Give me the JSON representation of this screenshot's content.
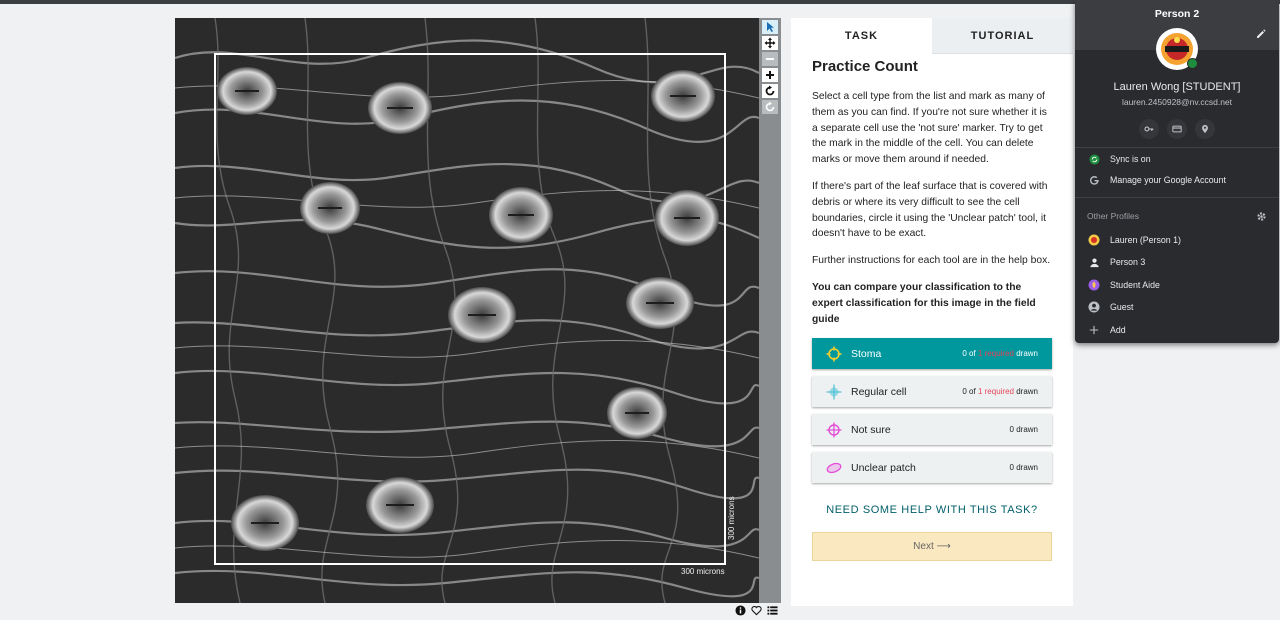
{
  "viewer": {
    "scale_h": "300 microns",
    "scale_v": "300 microns",
    "tools": [
      "pointer-icon",
      "move-icon",
      "zoom-out-icon",
      "zoom-in-icon",
      "rotate-icon",
      "reset-icon"
    ]
  },
  "tabs": {
    "task": "TASK",
    "tutorial": "TUTORIAL"
  },
  "task": {
    "title": "Practice Count",
    "para1": "Select a cell type from the list and mark as many of them as you can find. If you're not sure whether it is a separate cell use the 'not sure' marker. Try to get the mark in the middle of the cell. You can delete marks or move them around if needed.",
    "para2": "If there's part of the leaf surface that is covered with debris or where its very difficult to see the cell boundaries, circle it using the 'Unclear patch' tool, it doesn't have to be exact.",
    "para3": "Further instructions for each tool are in the help box.",
    "para4": "You can compare your classification to the expert classification for this image in the field guide",
    "tools": [
      {
        "label": "Stoma",
        "count_pre": "0 of ",
        "count_req": "1 required",
        "count_post": " drawn",
        "icon": "crosshair-icon",
        "color": "#f2d230"
      },
      {
        "label": "Regular cell",
        "count_pre": "0 of ",
        "count_req": "1 required",
        "count_post": " drawn",
        "icon": "crosshair-icon",
        "color": "#57c4d6"
      },
      {
        "label": "Not sure",
        "count_pre": "",
        "count_req": "",
        "count_post": "0 drawn",
        "icon": "crosshair-icon",
        "color": "#e34cd8"
      },
      {
        "label": "Unclear patch",
        "count_pre": "",
        "count_req": "",
        "count_post": "0 drawn",
        "icon": "ellipse-icon",
        "color": "#e34cd8"
      }
    ],
    "help": "NEED SOME HELP WITH THIS TASK?",
    "next": "Next ⟶"
  },
  "profile": {
    "header": "Person 2",
    "user": "Lauren Wong [STUDENT]",
    "email": "lauren.2450928@nv.ccsd.net",
    "sync": "Sync is on",
    "manage": "Manage your Google Account",
    "other_label": "Other Profiles",
    "others": [
      {
        "name": "Lauren (Person 1)",
        "icon": "avatar-icon"
      },
      {
        "name": "Person 3",
        "icon": "person-icon"
      },
      {
        "name": "Student Aide",
        "icon": "avatar-icon"
      },
      {
        "name": "Guest",
        "icon": "guest-icon"
      },
      {
        "name": "Add",
        "icon": "plus-icon"
      }
    ]
  }
}
